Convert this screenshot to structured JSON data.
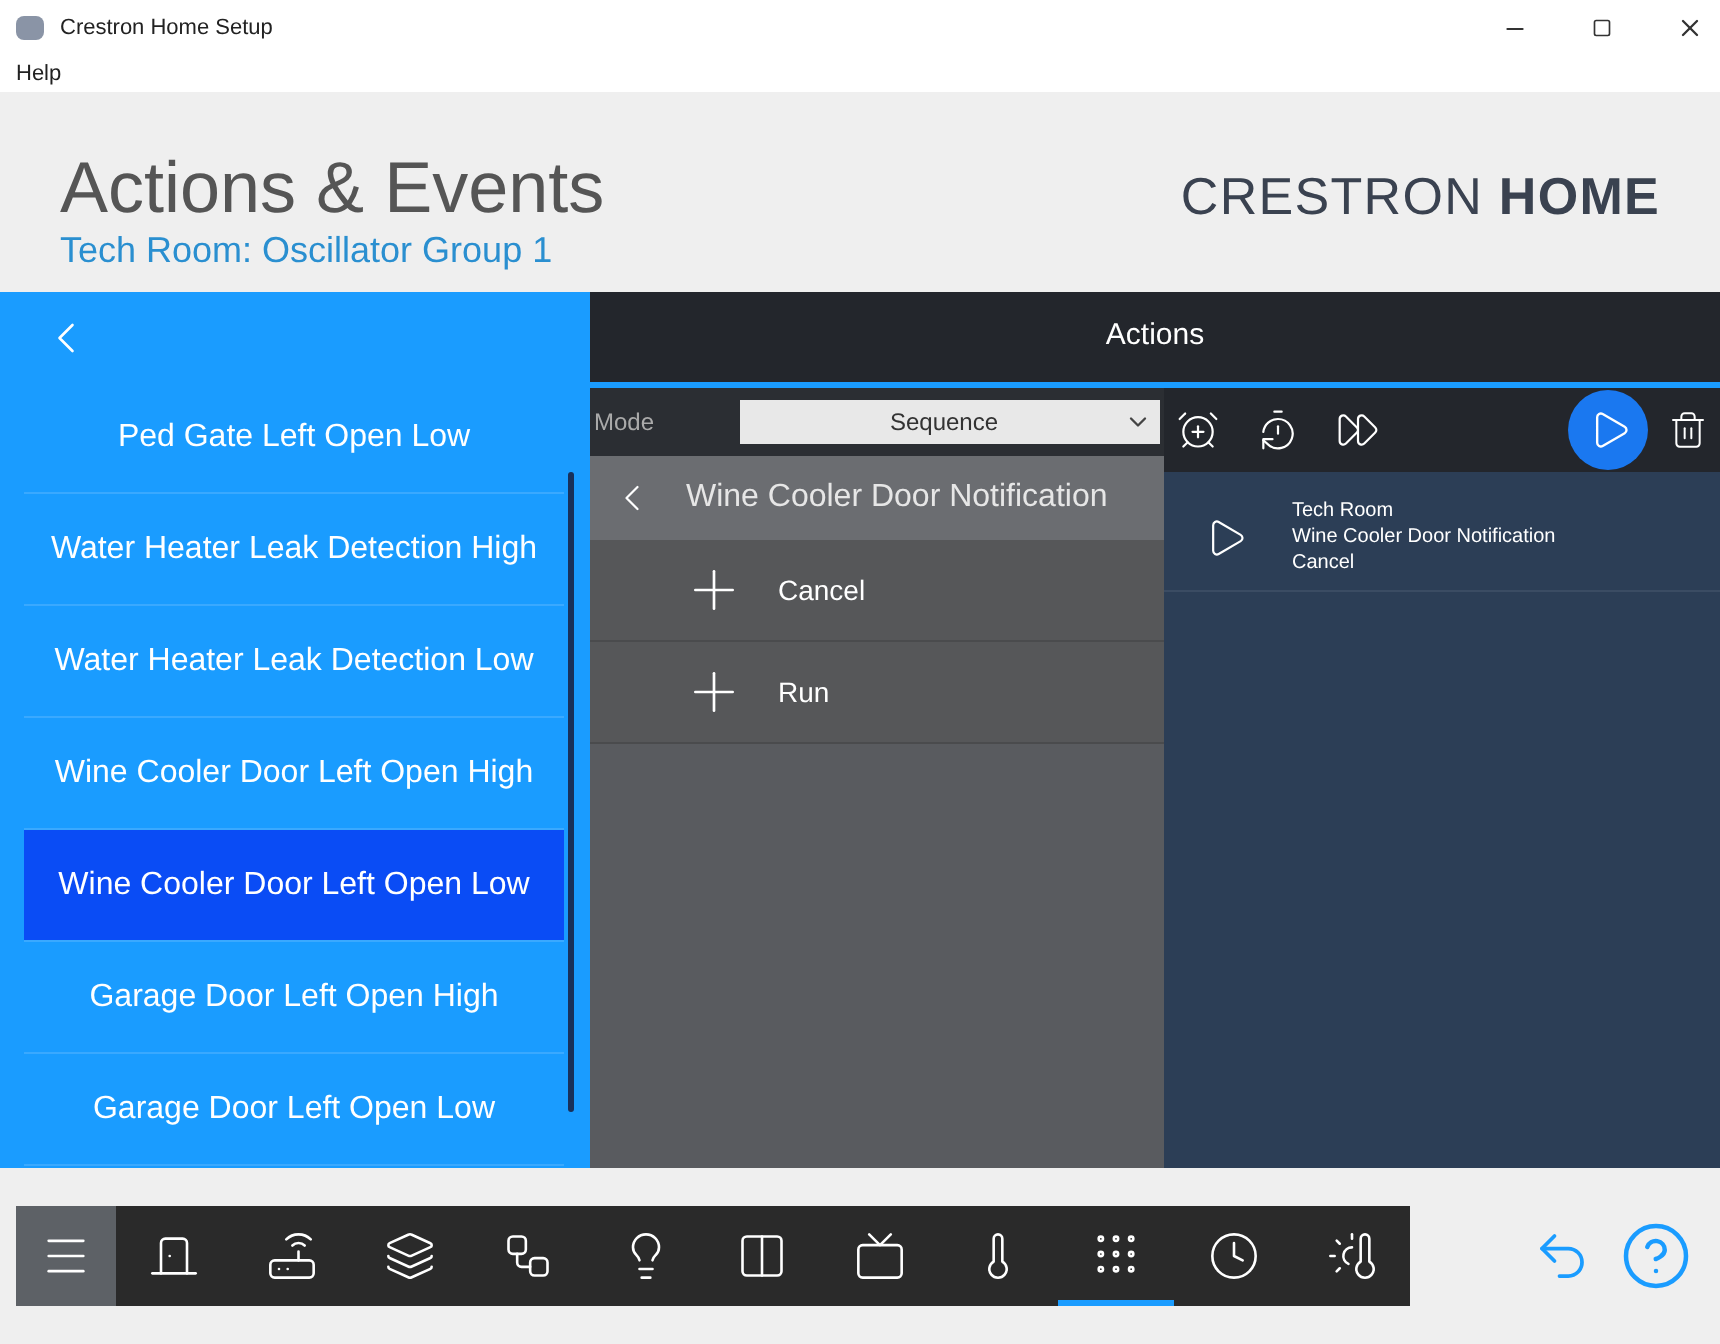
{
  "window": {
    "title": "Crestron Home Setup"
  },
  "menu": [
    "Help"
  ],
  "header": {
    "title": "Actions & Events",
    "subtitle": "Tech Room: Oscillator Group 1",
    "brand_light": "CRESTRON",
    "brand_bold": "HOME"
  },
  "events": [
    {
      "label": "Ped Gate Left Open Low",
      "selected": false
    },
    {
      "label": "Water Heater Leak Detection High",
      "selected": false
    },
    {
      "label": "Water Heater Leak Detection Low",
      "selected": false
    },
    {
      "label": "Wine Cooler Door Left Open High",
      "selected": false
    },
    {
      "label": "Wine Cooler Door Left Open Low",
      "selected": true
    },
    {
      "label": "Garage Door Left Open High",
      "selected": false
    },
    {
      "label": "Garage Door Left Open Low",
      "selected": false
    }
  ],
  "actions": {
    "title": "Actions",
    "mode_label": "Mode",
    "mode_value": "Sequence",
    "group_title": "Wine Cooler Door Notification",
    "options": [
      "Cancel",
      "Run"
    ],
    "sequence": [
      {
        "room": "Tech Room",
        "name": "Wine Cooler Door Notification",
        "action": "Cancel"
      }
    ]
  },
  "nav_bar": [
    {
      "selected": false
    },
    {
      "selected": false
    },
    {
      "selected": false
    },
    {
      "selected": false
    },
    {
      "selected": false
    },
    {
      "selected": false
    },
    {
      "selected": false
    },
    {
      "selected": false
    },
    {
      "selected": false
    },
    {
      "selected": true
    },
    {
      "selected": false
    },
    {
      "selected": false
    }
  ]
}
